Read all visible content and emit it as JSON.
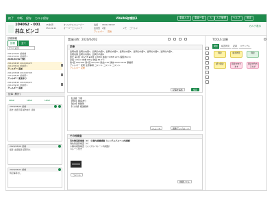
{
  "topbar": {
    "menu": [
      "終了",
      "中断",
      "保存",
      "カルテ保存"
    ],
    "center_title": "VRAIN6診療所1",
    "right_buttons": [
      "患者入力",
      "患者ー覧",
      "入",
      "入力管理",
      "ヘルプ",
      "設定"
    ]
  },
  "patient": {
    "id": "104062 - 001",
    "name": "共立 ビンゴ",
    "kana": "キョウリツ ビンゴ",
    "age_line": "45歳  男",
    "birth": "S50.02.21",
    "insurance_line1": "オリジナルキューパー",
    "insurance_line2": "オーバーエンジニア",
    "phone_label": "電話",
    "phone": "0801234567",
    "blood_label": "血液型",
    "blood": "A型",
    "allergy_label": "アレルギー",
    "allergy": "花粉",
    "memo_label": "メモ",
    "memo": "ゴールド",
    "link": "カルテ表示"
  },
  "left": {
    "header": "診療情報",
    "tabs": [
      {
        "label": "診療"
      },
      {
        "label": "全て"
      }
    ],
    "filter_label": "すべて表示",
    "visits": [
      {
        "date": "2019/10/01 診療前",
        "doc": "2019/10/01 診療所1",
        "comment": "2020/04/02 予約"
      },
      {
        "date": "2019/04/25 2019/04/25",
        "doc": "2019/05/02 診療所1",
        "comment": "アレルギー 追加"
      },
      {
        "date": "2019/07/08 2019/07/08",
        "doc": "2019/08/30 診療所1",
        "comment": "アレルギー 変更あり"
      },
      {
        "date": "2019/04/25 2019/04/25",
        "doc": "2019/09/23 診療所1",
        "comment": "アレルギー 追加"
      }
    ],
    "section_label": "記事 (累計)",
    "label_buttons": [
      "Label",
      "Label",
      "Label"
    ],
    "records": [
      {
        "header": "2020/04/02 診療",
        "body": "処方: 血圧の薬 処方あり 診察"
      },
      {
        "header": "2020/03/02 診療",
        "body": "検査: 血液検査 結果待ち"
      },
      {
        "header": "2020/02/01 診療",
        "body": "特記事項なし"
      }
    ]
  },
  "mid": {
    "date_label": "実施日時：2020/04/02",
    "sec_chart": {
      "title": "診療",
      "lines": [
        "質問内容 質問の内容1、質問の内容2、質問の内容3、質問の内容4、質問の内容5、質問の内容6、質問の内容7、",
        "質問内容 質問の内容8、質問の内容9",
        "血圧 第1回  116/78  第2回  118/80  脈拍 72  BMI 22.5  腹囲 80cm",
        "身長 170cm  体重 68kg  体温 36.5℃",
        "第1回 200/100  第2回 201/101  脈拍 120  通信 2020.04.02 事業所",
        "アレルギー 花粉  注意事項 コメント コメント コメント"
      ],
      "highlight": "アレルギー 花粉",
      "link": "記事を編集",
      "button": "保存"
    },
    "sec_memo": {
      "lines": [
        "【主訴】下痢",
        "【現症】腹痛あり",
        "【処方】整腸剤",
        "【その他】経過観察"
      ],
      "buttons": [
        "シェーマ",
        "画像アップロード"
      ]
    },
    "sec_other": {
      "title": "その他検査",
      "subtitle": "消化管造影検査（C） 小腸内視鏡検査（シングルバルーン内視鏡）",
      "items": [
        "消化管造影検査（C）",
        "小腸内視鏡検査（シングルバルーン内視鏡）",
        "バルーン付き"
      ],
      "comment_label": "コメント",
      "detail_link": "詳細リスト"
    }
  },
  "right": {
    "title": "TOOLS 診療",
    "tabs": [
      {
        "label": "問診"
      },
      {
        "label": "検査所見"
      },
      {
        "label": "記録"
      },
      {
        "label": "Vサンプル"
      }
    ],
    "tiles": [
      {
        "label": "問診",
        "color": "yellow"
      },
      {
        "label": "検査所見",
        "color": "yellow"
      },
      {
        "label": "問診",
        "color": "green"
      },
      {
        "label": "紹介問診",
        "color": "yellow"
      },
      {
        "label": "問診を作ります",
        "color": "pink"
      },
      {
        "label": "問診が作れるのが",
        "color": "pink"
      }
    ]
  },
  "colors": {
    "brand": "#1e8a4c",
    "highlight": "#fff6d9",
    "orange": "#d86a1a"
  }
}
